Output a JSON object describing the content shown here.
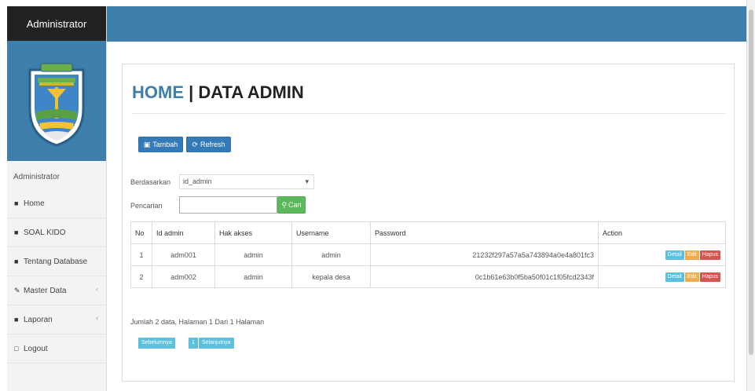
{
  "sidebar": {
    "title": "Administrator",
    "user_label": "Administrator",
    "items": [
      {
        "label": "Home",
        "icon": "home-icon"
      },
      {
        "label": "SOAL KIDO",
        "icon": "home-icon"
      },
      {
        "label": "Tentang Database",
        "icon": "home-icon"
      },
      {
        "label": "Master Data",
        "icon": "edit-icon",
        "has_chevron": true
      },
      {
        "label": "Laporan",
        "icon": "report-icon",
        "has_chevron": true
      },
      {
        "label": "Logout",
        "icon": "logout-icon"
      }
    ]
  },
  "page": {
    "title_home": "HOME",
    "title_sep": " | ",
    "title_rest": "DATA ADMIN"
  },
  "toolbar": {
    "add_label": "Tambah",
    "refresh_label": "Refresh"
  },
  "filter": {
    "sort_label": "Berdasarkan",
    "sort_value": "id_admin",
    "search_label": "Pencarian",
    "search_value": "",
    "search_button": "Cari"
  },
  "table": {
    "headers": [
      "No",
      "Id admin",
      "Hak akses",
      "Username",
      "Password",
      "Action"
    ],
    "rows": [
      {
        "no": "1",
        "id": "adm001",
        "hak": "admin",
        "username": "admin",
        "password": "21232f297a57a5a743894a0e4a801fc3"
      },
      {
        "no": "2",
        "id": "adm002",
        "hak": "admin",
        "username": "kepala desa",
        "password": "0c1b61e63b0f5ba50f01c1f05fcd2343f"
      }
    ],
    "actions": {
      "detail": "Detail",
      "edit": "Edit",
      "hapus": "Hapus"
    }
  },
  "summary": "Jumlah 2 data, Halaman 1 Dari 1 Halaman",
  "pagination": {
    "prev": "Sebelumnya",
    "current": "1",
    "next": "Selanjutnya"
  },
  "colors": {
    "brand": "#3d7eaa",
    "sidebar_head": "#222222",
    "primary": "#337ab7",
    "success": "#5cb85c",
    "danger": "#d9534f",
    "warning": "#f0ad4e",
    "info": "#5bc0de"
  }
}
